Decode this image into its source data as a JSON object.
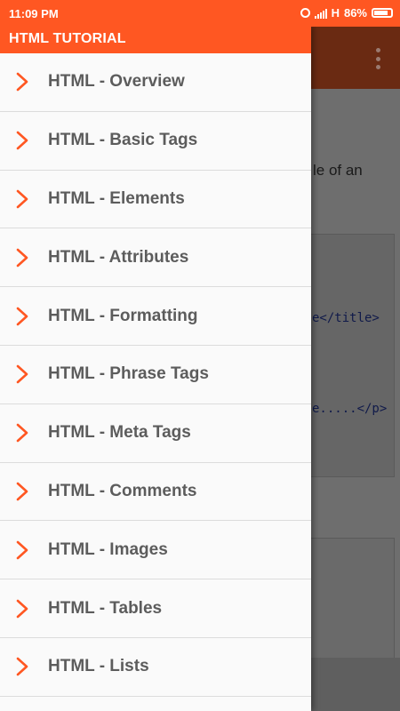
{
  "status_bar": {
    "time": "11:09 PM",
    "network": "H",
    "battery": "86%"
  },
  "drawer": {
    "title": "HTML TUTORIAL",
    "items": [
      {
        "label": "HTML - Overview"
      },
      {
        "label": "HTML - Basic Tags"
      },
      {
        "label": "HTML - Elements"
      },
      {
        "label": "HTML - Attributes"
      },
      {
        "label": "HTML - Formatting"
      },
      {
        "label": "HTML - Phrase Tags"
      },
      {
        "label": "HTML - Meta Tags"
      },
      {
        "label": "HTML - Comments"
      },
      {
        "label": "HTML - Images"
      },
      {
        "label": "HTML - Tables"
      },
      {
        "label": "HTML - Lists"
      }
    ]
  },
  "background": {
    "text_fragment": "le of an",
    "code_line_1": "e</title>",
    "code_line_2": "e.....</p>"
  },
  "colors": {
    "accent": "#ff5722",
    "chevron": "#ff5722",
    "label": "#5c5c5c"
  },
  "icons": {
    "chevron": "chevron-right-icon",
    "overflow": "overflow-menu-icon"
  }
}
